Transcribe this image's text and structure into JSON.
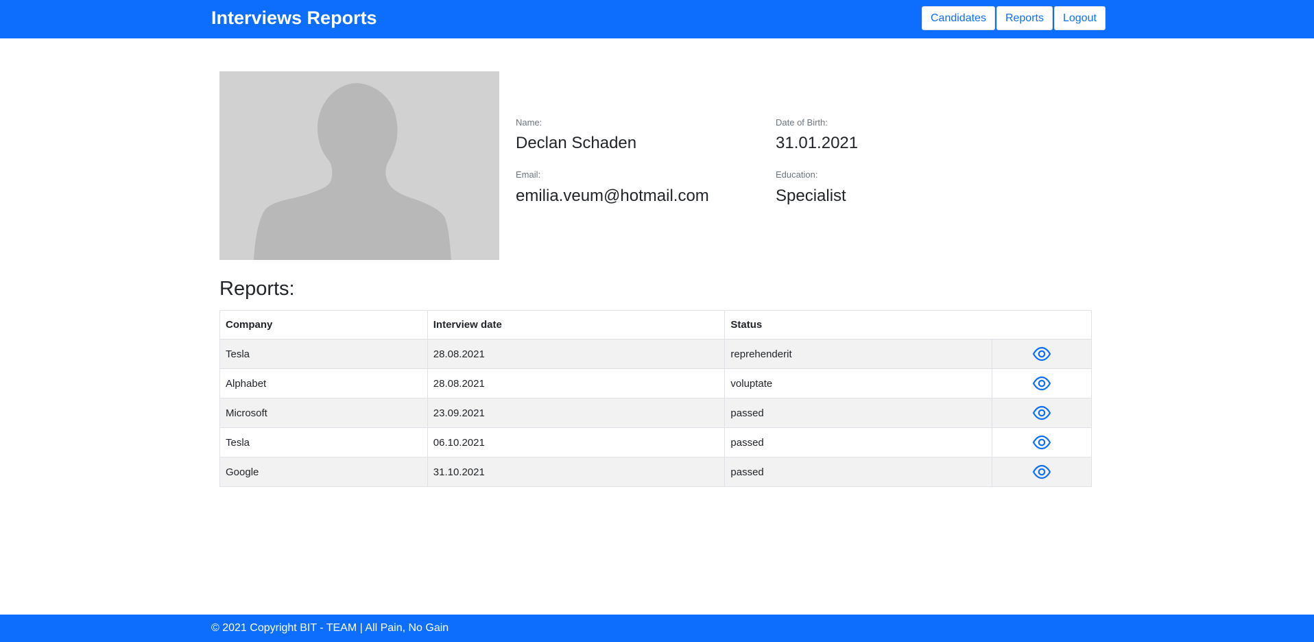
{
  "header": {
    "title": "Interviews Reports",
    "nav": [
      {
        "label": "Candidates"
      },
      {
        "label": "Reports"
      },
      {
        "label": "Logout"
      }
    ]
  },
  "candidate": {
    "photo_icon": "person-silhouette-icon",
    "name_label": "Name:",
    "name": "Declan Schaden",
    "dob_label": "Date of Birth:",
    "dob": "31.01.2021",
    "email_label": "Email:",
    "email": "emilia.veum@hotmail.com",
    "education_label": "Education:",
    "education": "Specialist"
  },
  "reports": {
    "title": "Reports:",
    "columns": [
      "Company",
      "Interview date",
      "Status",
      ""
    ],
    "rows": [
      {
        "company": "Tesla",
        "date": "28.08.2021",
        "status": "reprehenderit",
        "action_icon": "eye-icon"
      },
      {
        "company": "Alphabet",
        "date": "28.08.2021",
        "status": "voluptate",
        "action_icon": "eye-icon"
      },
      {
        "company": "Microsoft",
        "date": "23.09.2021",
        "status": "passed",
        "action_icon": "eye-icon"
      },
      {
        "company": "Tesla",
        "date": "06.10.2021",
        "status": "passed",
        "action_icon": "eye-icon"
      },
      {
        "company": "Google",
        "date": "31.10.2021",
        "status": "passed",
        "action_icon": "eye-icon"
      }
    ]
  },
  "footer": {
    "text": "© 2021 Copyright BIT - TEAM | All Pain, No Gain"
  },
  "colors": {
    "primary": "#0d6efd",
    "photo_bg": "#d1d1d1",
    "silhouette": "#b8b8b8",
    "striped_row": "#f2f2f2"
  }
}
